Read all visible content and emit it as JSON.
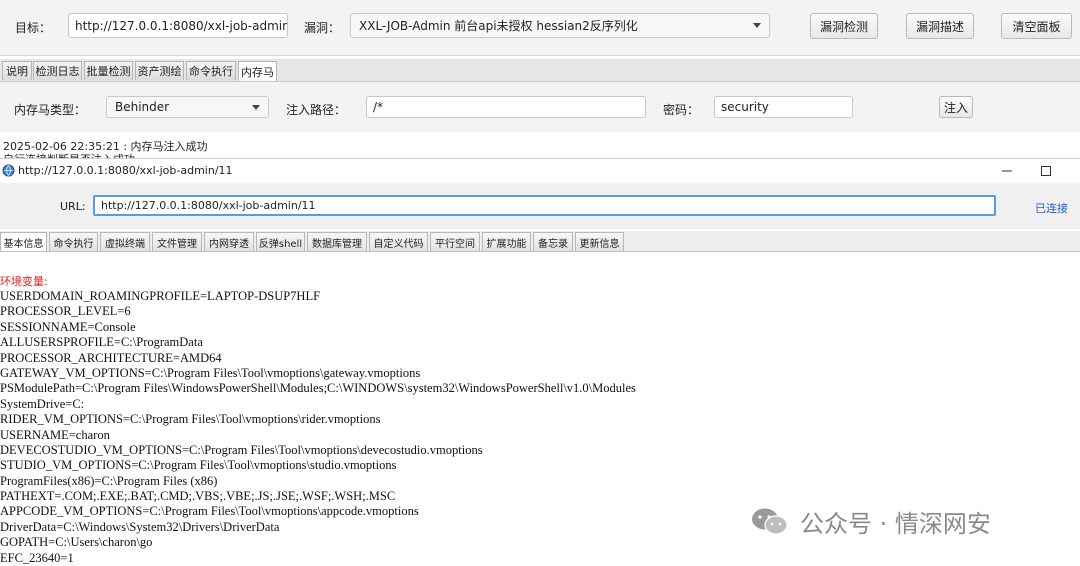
{
  "top": {
    "target_label": "目标：",
    "target_value": "http://127.0.0.1:8080/xxl-job-admin",
    "vuln_label": "漏洞：",
    "vuln_selected": "XXL-JOB-Admin 前台api未授权 hessian2反序列化",
    "buttons": {
      "detect": "漏洞检测",
      "describe": "漏洞描述",
      "clear": "清空面板"
    }
  },
  "main_tabs": [
    "说明",
    "检测日志",
    "批量检测",
    "资产测绘",
    "命令执行",
    "内存马"
  ],
  "memshell": {
    "type_label": "内存马类型：",
    "type_value": "Behinder",
    "path_label": "注入路径：",
    "path_value": "/*",
    "password_label": "密码：",
    "password_value": "security",
    "inject_button": "注入"
  },
  "log": {
    "line1": "2025-02-06 22:35:21 : 内存马注入成功",
    "line2": "自行连接判断是否注入成功"
  },
  "shell_window": {
    "title": "http://127.0.0.1:8080/xxl-job-admin/11",
    "url_label": "URL:",
    "url_value": "http://127.0.0.1:8080/xxl-job-admin/11",
    "status": "已连接",
    "tabs": [
      "基本信息",
      "命令执行",
      "虚拟终端",
      "文件管理",
      "内网穿透",
      "反弹shell",
      "数据库管理",
      "自定义代码",
      "平行空间",
      "扩展功能",
      "备忘录",
      "更新信息"
    ],
    "env_header": "环境变量:",
    "env_lines": [
      "USERDOMAIN_ROAMINGPROFILE=LAPTOP-DSUP7HLF",
      "PROCESSOR_LEVEL=6",
      "SESSIONNAME=Console",
      "ALLUSERSPROFILE=C:\\ProgramData",
      "PROCESSOR_ARCHITECTURE=AMD64",
      "GATEWAY_VM_OPTIONS=C:\\Program Files\\Tool\\vmoptions\\gateway.vmoptions",
      "PSModulePath=C:\\Program Files\\WindowsPowerShell\\Modules;C:\\WINDOWS\\system32\\WindowsPowerShell\\v1.0\\Modules",
      "SystemDrive=C:",
      "RIDER_VM_OPTIONS=C:\\Program Files\\Tool\\vmoptions\\rider.vmoptions",
      "USERNAME=charon",
      "DEVECOSTUDIO_VM_OPTIONS=C:\\Program Files\\Tool\\vmoptions\\devecostudio.vmoptions",
      "STUDIO_VM_OPTIONS=C:\\Program Files\\Tool\\vmoptions\\studio.vmoptions",
      "ProgramFiles(x86)=C:\\Program Files (x86)",
      "PATHEXT=.COM;.EXE;.BAT;.CMD;.VBS;.VBE;.JS;.JSE;.WSF;.WSH;.MSC",
      "APPCODE_VM_OPTIONS=C:\\Program Files\\Tool\\vmoptions\\appcode.vmoptions",
      "DriverData=C:\\Windows\\System32\\Drivers\\DriverData",
      "GOPATH=C:\\Users\\charon\\go",
      "EFC_23640=1"
    ]
  },
  "watermark": {
    "text": "公众号 · 情深网安",
    "icon": "wechat-icon"
  }
}
